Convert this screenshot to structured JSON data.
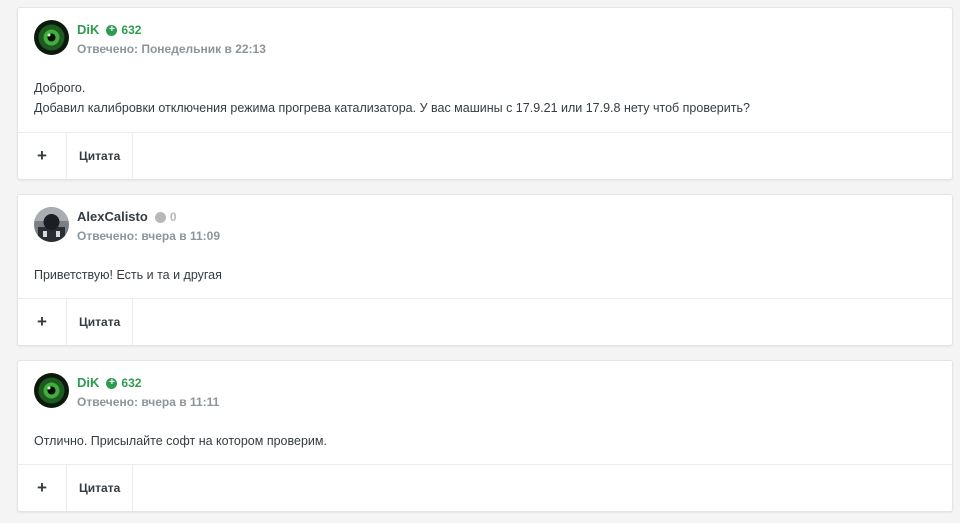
{
  "colors": {
    "dik_name": "#2e9b4f",
    "positive_rep": "#2e9b4f",
    "neutral_rep": "#b8b8b8",
    "author_dark": "#353c41",
    "meta_gray": "#8e959a"
  },
  "posts": [
    {
      "author": "DiK",
      "rep_icon": "plus-circle-icon",
      "reputation": "632",
      "meta": "Отвечено: Понедельник в 22:13",
      "content": [
        "Доброго.",
        "Добавил калибровки отключения режима прогрева катализатора. У вас машины с 17.9.21 или 17.9.8 нету чтоб проверить?"
      ],
      "plus_label": "+",
      "quote_label": "Цитата"
    },
    {
      "author": "AlexCalisto",
      "rep_icon": "neutral-circle-icon",
      "reputation": "0",
      "meta": "Отвечено: вчера в 11:09",
      "content": [
        "Приветствую! Есть и та и другая"
      ],
      "plus_label": "+",
      "quote_label": "Цитата"
    },
    {
      "author": "DiK",
      "rep_icon": "plus-circle-icon",
      "reputation": "632",
      "meta": "Отвечено: вчера в 11:11",
      "content": [
        "Отлично. Присылайте софт на котором проверим."
      ],
      "plus_label": "+",
      "quote_label": "Цитата"
    }
  ]
}
